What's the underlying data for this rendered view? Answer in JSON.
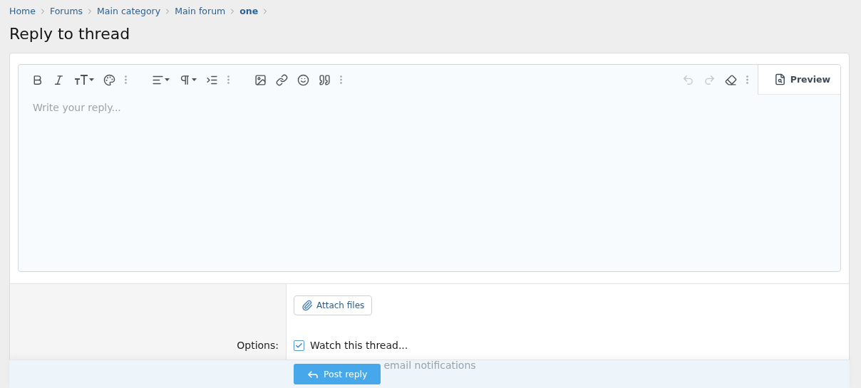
{
  "breadcrumbs": [
    {
      "label": "Home",
      "selected": false
    },
    {
      "label": "Forums",
      "selected": false
    },
    {
      "label": "Main category",
      "selected": false
    },
    {
      "label": "Main forum",
      "selected": false
    },
    {
      "label": "one",
      "selected": true
    }
  ],
  "title": "Reply to thread",
  "editor": {
    "placeholder": "Write your reply...",
    "undo": {
      "disabled": true
    },
    "redo": {
      "disabled": true
    },
    "preview": "Preview"
  },
  "attach": "Attach files",
  "options_label": "Options:",
  "options": [
    {
      "label": "Watch this thread...",
      "checked": true
    }
  ],
  "covered_option": "email notifications",
  "submit": "Post reply"
}
